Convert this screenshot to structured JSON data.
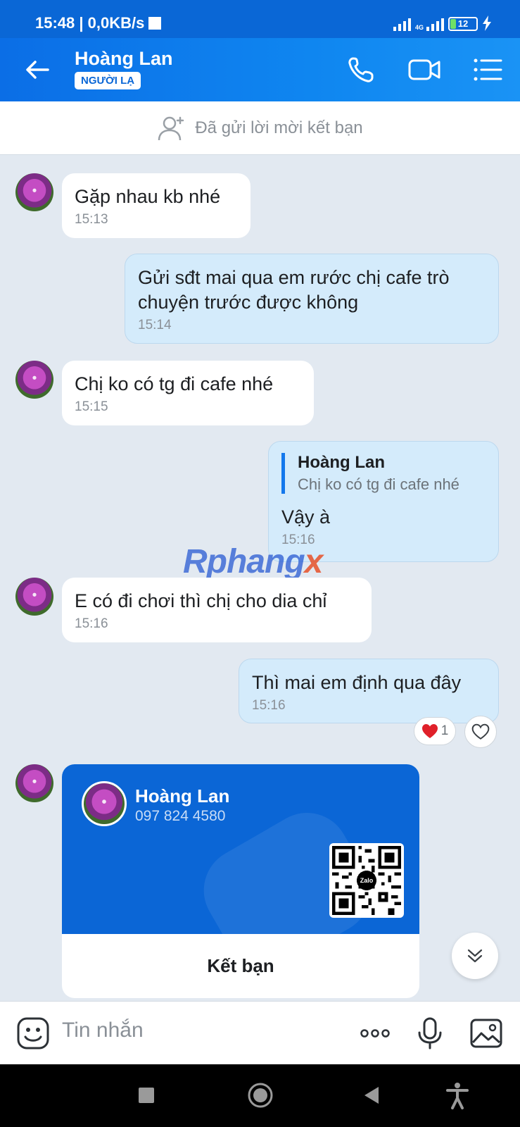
{
  "status": {
    "time": "15:48 | 0,0KB/s",
    "network": "4G",
    "battery": "12"
  },
  "header": {
    "name": "Hoàng Lan",
    "badge": "NGƯỜI LẠ"
  },
  "request_bar": {
    "text": "Đã gửi lời mời kết bạn"
  },
  "messages": [
    {
      "dir": "in",
      "text": "Gặp nhau kb nhé",
      "time": "15:13"
    },
    {
      "dir": "out",
      "text": "Gửi sđt mai qua em rước chị cafe trò chuyện trước được không",
      "time": "15:14"
    },
    {
      "dir": "in",
      "text": "Chị ko có tg đi cafe nhé",
      "time": "15:15"
    },
    {
      "dir": "out",
      "quote_name": "Hoàng Lan",
      "quote_text": "Chị ko có tg đi cafe nhé",
      "text": "Vậy à",
      "time": "15:16"
    },
    {
      "dir": "in",
      "text": "E có đi chơi thì chị cho dia chỉ",
      "time": "15:16"
    },
    {
      "dir": "out",
      "text": "Thì mai em định qua đây",
      "time": "15:16",
      "reaction_count": "1"
    }
  ],
  "watermark": {
    "main": "Rphang",
    "tail": "x"
  },
  "contact_card": {
    "name": "Hoàng Lan",
    "phone": "097 824 4580",
    "qr_label": "Zalo",
    "button": "Kết bạn"
  },
  "input": {
    "placeholder": "Tin nhắn"
  },
  "colors": {
    "brand": "#0a67d6",
    "outgoing": "#d4ebfb",
    "background": "#e2e9f1"
  }
}
